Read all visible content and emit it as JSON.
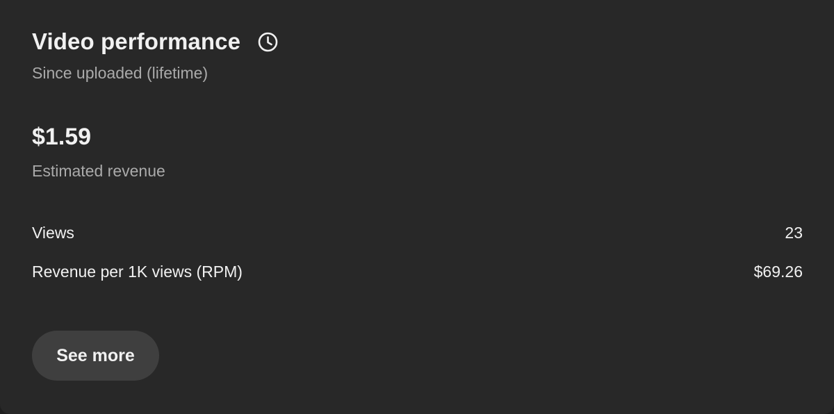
{
  "card": {
    "title": "Video performance",
    "subtitle": "Since uploaded (lifetime)",
    "revenue": {
      "value": "$1.59",
      "label": "Estimated revenue"
    },
    "metrics": [
      {
        "label": "Views",
        "value": "23"
      },
      {
        "label": "Revenue per 1K views (RPM)",
        "value": "$69.26"
      }
    ],
    "see_more_label": "See more",
    "title_icon": "clock-icon"
  },
  "colors": {
    "card_background": "#282828",
    "primary_text": "#f1f1f1",
    "secondary_text": "#aaaaaa",
    "button_background": "#3f3f3f"
  }
}
